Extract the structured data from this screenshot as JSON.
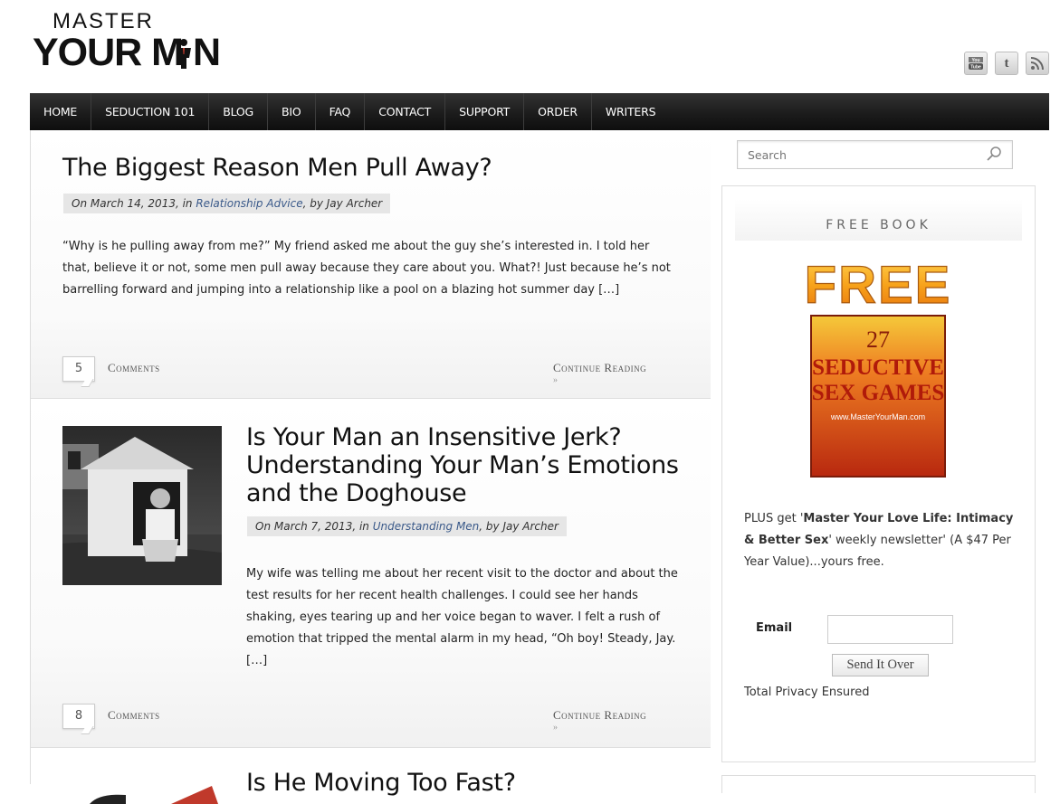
{
  "logo": {
    "line1": "MASTER",
    "line2": "YOUR M N"
  },
  "social": [
    {
      "icon": "youtube-icon",
      "label": "You Tube"
    },
    {
      "icon": "twitter-icon",
      "label": "t"
    },
    {
      "icon": "rss-icon",
      "label": ""
    }
  ],
  "nav": [
    "HOME",
    "SEDUCTION 101",
    "BLOG",
    "BIO",
    "FAQ",
    "CONTACT",
    "SUPPORT",
    "ORDER",
    "WRITERS"
  ],
  "posts": [
    {
      "title": "The Biggest Reason Men Pull Away?",
      "meta_prefix": "On March 14, 2013, in ",
      "category": "Relationship Advice",
      "meta_suffix": ", by Jay Archer",
      "excerpt": "“Why is he pulling away from me?” My friend asked me about the guy she’s interested in. I told her that, believe it or not, some men pull away because they care about you. What?! Just because he’s not barrelling forward and jumping into a relationship like a pool on a blazing hot summer day […]",
      "comments": "5",
      "comments_label": "Comments",
      "continue_label": "Continue Reading",
      "continue_arrow": "»"
    },
    {
      "title": "Is Your Man an Insensitive Jerk? Understanding Your Man’s Emotions and the Doghouse",
      "meta_prefix": "On March 7, 2013, in ",
      "category": "Understanding Men",
      "meta_suffix": ", by Jay Archer",
      "excerpt": "My wife was telling me about her recent visit to the doctor and about the test results for her recent health challenges. I could see her hands shaking, eyes tearing up and her voice began to waver. I felt a rush of emotion that tripped the mental alarm in my head, “Oh boy! Steady, Jay. […]",
      "comments": "8",
      "comments_label": "Comments",
      "continue_label": "Continue Reading",
      "continue_arrow": "»"
    },
    {
      "title": "Is He Moving Too Fast?"
    }
  ],
  "search": {
    "placeholder": "Search"
  },
  "widget": {
    "title": "FREE BOOK",
    "book_badge": "FREE",
    "book_number": "27",
    "book_line1": "SEDUCTIVE",
    "book_line2": "SEX GAMES",
    "book_url": "www.MasterYourMan.com",
    "text_prefix": "PLUS get '",
    "text_bold": "Master Your Love Life: Intimacy & Better Sex",
    "text_suffix": "' weekly newsletter' (A $47 Per Year Value)...yours free.",
    "email_label": "Email",
    "email_value": "",
    "button_label": "Send It Over",
    "privacy": "Total Privacy Ensured"
  },
  "colors": {
    "nav_bg": "#1c1c1c",
    "link": "#3b5a8a",
    "meta_bg": "#e6e6e6",
    "free_orange": "#f7a21b",
    "book_red": "#d7401c"
  }
}
